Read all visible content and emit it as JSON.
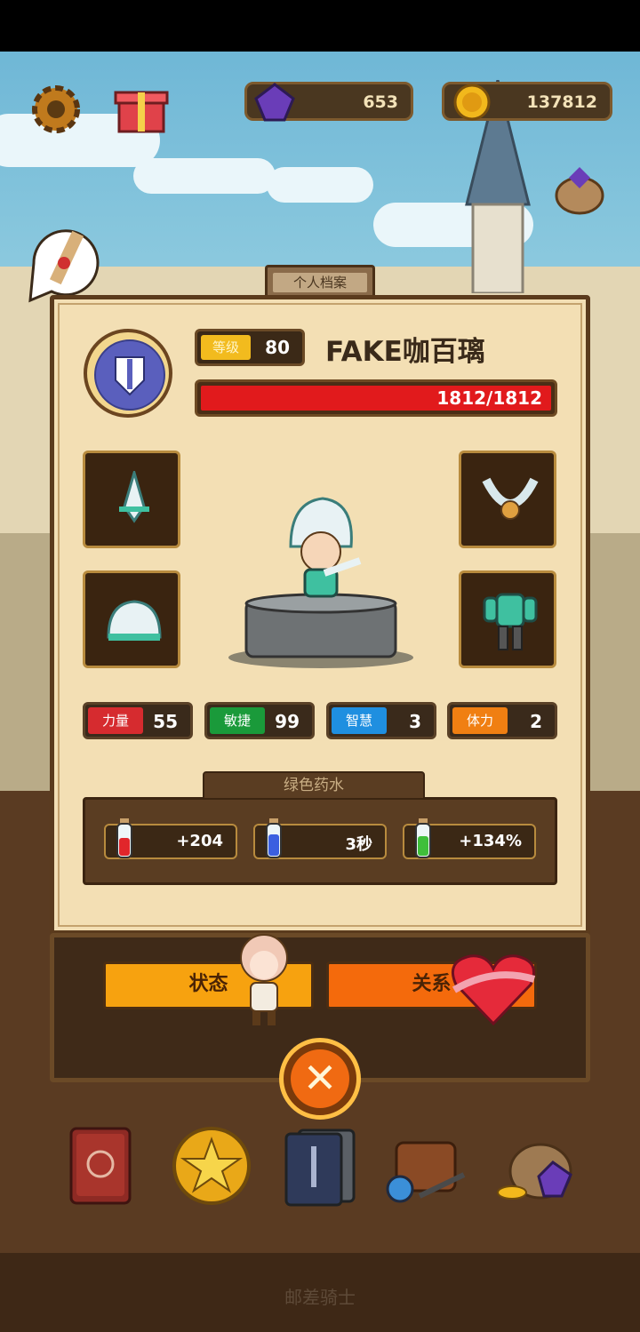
{
  "hud": {
    "gems": "653",
    "coins": "137812"
  },
  "profile": {
    "tab_label": "个人档案",
    "level_label": "等级",
    "level": "80",
    "name": "FAKE咖百璃",
    "hp_text": "1812/1812",
    "hp_fraction": 1.0
  },
  "stats": [
    {
      "label": "力量",
      "value": "55",
      "color": "#d62b2f"
    },
    {
      "label": "敏捷",
      "value": "99",
      "color": "#1a9a3a"
    },
    {
      "label": "智慧",
      "value": "3",
      "color": "#1f8fe0"
    },
    {
      "label": "体力",
      "value": "2",
      "color": "#f07f12"
    }
  ],
  "potions": {
    "title": "绿色药水",
    "items": [
      {
        "value": "+204",
        "icon": "heart-potion-icon",
        "color": "#e1262b"
      },
      {
        "value": "3秒",
        "icon": "hourglass-potion-icon",
        "color": "#3b5fe0"
      },
      {
        "value": "+134%",
        "icon": "green-potion-icon",
        "color": "#3fbf3a"
      }
    ]
  },
  "actions": {
    "status_label": "状态",
    "relation_label": "关系"
  },
  "footer": {
    "title": "邮差骑士"
  }
}
